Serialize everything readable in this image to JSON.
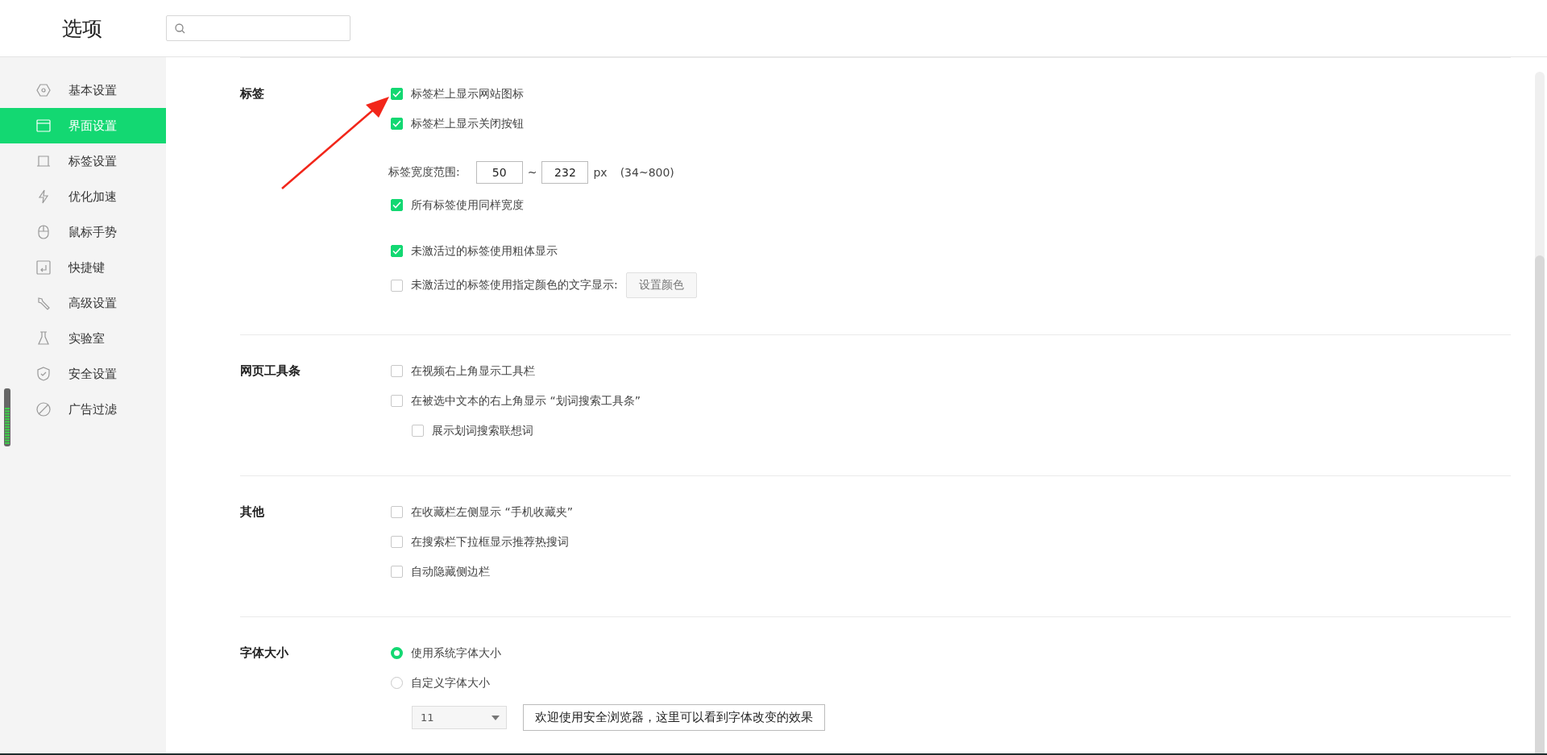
{
  "window": {
    "title": "选项"
  },
  "sidebar": {
    "items": [
      {
        "label": "基本设置",
        "selected": false
      },
      {
        "label": "界面设置",
        "selected": true
      },
      {
        "label": "标签设置",
        "selected": false
      },
      {
        "label": "优化加速",
        "selected": false
      },
      {
        "label": "鼠标手势",
        "selected": false
      },
      {
        "label": "快捷键",
        "selected": false
      },
      {
        "label": "高级设置",
        "selected": false
      },
      {
        "label": "实验室",
        "selected": false
      },
      {
        "label": "安全设置",
        "selected": false
      },
      {
        "label": "广告过滤",
        "selected": false
      }
    ]
  },
  "sections": [
    {
      "title": "标签",
      "groups": [
        [
          {
            "kind": "checkbox",
            "label": "标签栏上显示网站图标",
            "checked": true
          },
          {
            "kind": "checkbox",
            "label": "标签栏上显示关闭按钮",
            "checked": true
          }
        ],
        [
          {
            "kind": "range",
            "label": "标签宽度范围:",
            "min": "50",
            "separator": "~",
            "max": "232",
            "unit": "px",
            "hint": "(34~800)"
          },
          {
            "kind": "checkbox",
            "label": "所有标签使用同样宽度",
            "checked": true
          }
        ],
        [
          {
            "kind": "checkbox",
            "label": "未激活过的标签使用粗体显示",
            "checked": true
          },
          {
            "kind": "checkbox",
            "label": "未激活过的标签使用指定颜色的文字显示:",
            "checked": false,
            "button": "设置颜色"
          }
        ]
      ]
    },
    {
      "title": "网页工具条",
      "groups": [
        [
          {
            "kind": "checkbox",
            "label": "在视频右上角显示工具栏",
            "checked": false
          },
          {
            "kind": "checkbox",
            "label": "在被选中文本的右上角显示 “划词搜索工具条”",
            "checked": false,
            "children": [
              {
                "kind": "checkbox",
                "label": "展示划词搜索联想词",
                "checked": false
              }
            ]
          }
        ]
      ]
    },
    {
      "title": "其他",
      "groups": [
        [
          {
            "kind": "checkbox",
            "label": "在收藏栏左侧显示 “手机收藏夹”",
            "checked": false
          },
          {
            "kind": "checkbox",
            "label": "在搜索栏下拉框显示推荐热搜词",
            "checked": false
          },
          {
            "kind": "checkbox",
            "label": "自动隐藏侧边栏",
            "checked": false
          }
        ]
      ]
    },
    {
      "title": "字体大小",
      "groups": [
        [
          {
            "kind": "radio",
            "label": "使用系统字体大小",
            "selected": true
          },
          {
            "kind": "radio",
            "label": "自定义字体大小",
            "selected": false
          },
          {
            "kind": "font",
            "value": "11",
            "preview": "欢迎使用安全浏览器，这里可以看到字体改变的效果"
          }
        ]
      ]
    }
  ]
}
